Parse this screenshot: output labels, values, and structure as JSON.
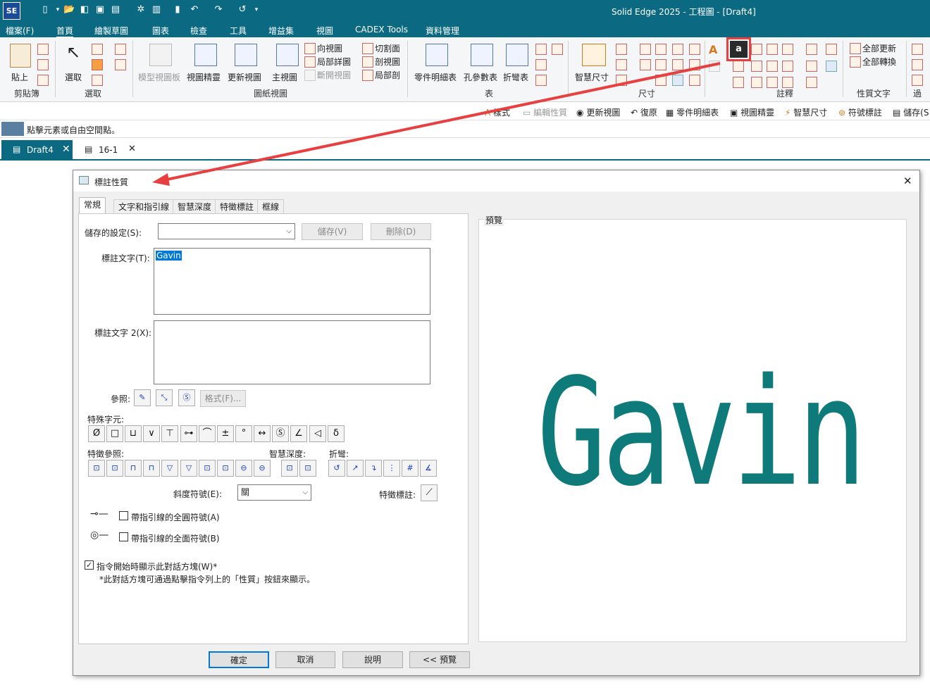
{
  "app": {
    "logo": "SE",
    "title": "Solid Edge 2025 - 工程圖 - [Draft4]"
  },
  "menu": {
    "file": "檔案(F)",
    "tabs": [
      "首頁",
      "繪製草圖",
      "圖表",
      "檢查",
      "工具",
      "增益集",
      "視圖",
      "CADEX Tools",
      "資料管理"
    ],
    "active": "首頁"
  },
  "ribbon": {
    "paste": "貼上",
    "select": "選取",
    "model_board": "模型視圖板",
    "view_wizard": "視圖精靈",
    "update_view": "更新視圖",
    "principal_view": "主視圖",
    "aux_view": "向視圖",
    "detail_view": "局部詳圖",
    "broken_view": "斷開視圖",
    "cutting_plane": "切割面",
    "section_view": "剖視圖",
    "partial_section": "局部剖",
    "parts_list": "零件明細表",
    "hole_table": "孔參數表",
    "bend_table": "折彎表",
    "smart_dimension": "智慧尺寸",
    "update_all": "全部更新",
    "convert_all": "全部轉換",
    "partial_label": "過",
    "groups": {
      "clipboard": "剪貼簿",
      "select": "選取",
      "drawing_views": "圖紙視圖",
      "tables": "表",
      "dimension": "尺寸",
      "annotation": "註釋",
      "property_text": "性質文字"
    }
  },
  "qat": {
    "items": [
      "樣式",
      "編輯性質",
      "更新視圖",
      "復原",
      "零件明細表",
      "視圖精靈",
      "智慧尺寸",
      "符號標註",
      "儲存(S"
    ]
  },
  "prompt": "點擊元素或自由空間點。",
  "doc_tabs": [
    {
      "label": "Draft4",
      "active": true
    },
    {
      "label": "16-1",
      "active": false
    }
  ],
  "dialog": {
    "title": "標註性質",
    "tabs": [
      "常規",
      "文字和指引線",
      "智慧深度",
      "特徵標註",
      "框線"
    ],
    "saved_settings_label": "儲存的設定(S):",
    "saved_settings_value": "",
    "save_button": "儲存(V)",
    "delete_button": "刪除(D)",
    "callout_text_label": "標註文字(T):",
    "callout_text_value": "Gavin",
    "callout_text2_label": "標註文字 2(X):",
    "callout_text2_value": "",
    "reference_label": "參照:",
    "format_button": "格式(F)...",
    "special_chars_label": "特殊字元:",
    "special_chars": [
      "Ø",
      "□",
      "⊔",
      "∨",
      "⊤",
      "⊶",
      "⌒",
      "±",
      "°",
      "↔",
      "Ⓢ",
      "∠",
      "◁",
      "δ"
    ],
    "feature_ref_label": "特徵參照:",
    "smart_depth_label": "智慧深度:",
    "bend_label": "折彎:",
    "slope_label": "斜度符號(E):",
    "slope_value": "關",
    "feature_callout_label": "特徵標註:",
    "all_around_leader": "帶指引線的全圓符號(A)",
    "all_over_leader": "帶指引線的全面符號(B)",
    "show_on_start": "指令開始時顯示此對話方塊(W)*",
    "show_on_start_checked": true,
    "note": "*此對話方塊可通過點擊指令列上的「性質」按鈕來顯示。",
    "preview_label": "預覽",
    "preview_text": "Gavin",
    "ok": "確定",
    "cancel": "取消",
    "help": "說明",
    "preview_btn": "<< 預覽"
  },
  "colors": {
    "title_bar": "#0b6a82",
    "preview_text": "#0e7a7a",
    "highlight": "#e84040",
    "selection": "#0078d7"
  }
}
